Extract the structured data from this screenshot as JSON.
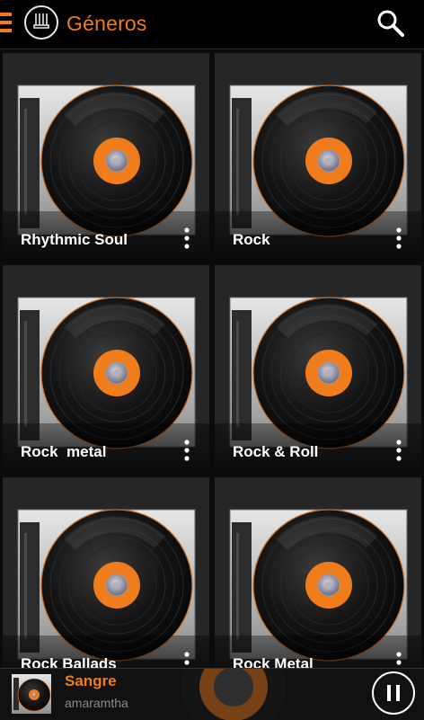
{
  "header": {
    "title": "Géneros"
  },
  "genres": [
    {
      "label": "Rhythmic Soul"
    },
    {
      "label": "Rock"
    },
    {
      "label": "Rock  metal"
    },
    {
      "label": "Rock & Roll"
    },
    {
      "label": "Rock Ballads"
    },
    {
      "label": "Rock Metal"
    }
  ],
  "player": {
    "song": "Sangre",
    "artist": "amaramtha"
  },
  "colors": {
    "accent": "#f07c1b",
    "background": "#0b0b0b",
    "tile": "#272727"
  },
  "icons": {
    "menu": "hamburger-icon",
    "logo": "app-logo",
    "search": "search-icon",
    "more": "more-vertical-icon",
    "pause": "pause-icon"
  }
}
